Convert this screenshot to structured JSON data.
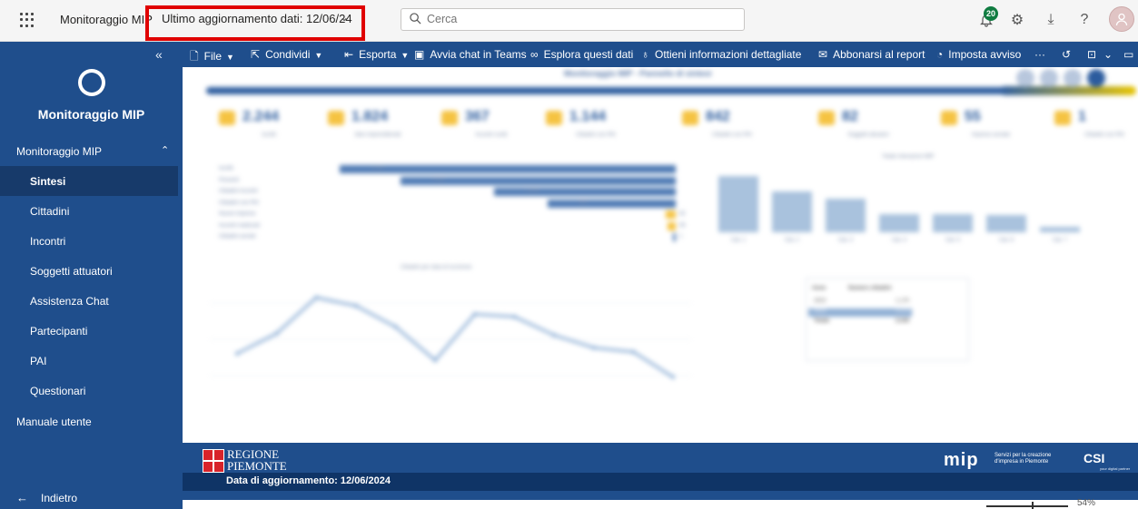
{
  "topbar": {
    "app_title": "Monitoraggio MIP",
    "update_label": "Ultimo aggiornamento dati: 12/06/24",
    "search_placeholder": "Cerca",
    "notification_count": "20",
    "highlight_color": "#e00000"
  },
  "sidebar": {
    "title": "Monitoraggio MIP",
    "section_label": "Monitoraggio MIP",
    "items": [
      {
        "label": "Sintesi",
        "active": true
      },
      {
        "label": "Cittadini",
        "active": false
      },
      {
        "label": "Incontri",
        "active": false
      },
      {
        "label": "Soggetti attuatori",
        "active": false
      },
      {
        "label": "Assistenza Chat",
        "active": false
      },
      {
        "label": "Partecipanti",
        "active": false
      },
      {
        "label": "PAI",
        "active": false
      },
      {
        "label": "Questionari",
        "active": false
      }
    ],
    "manual_label": "Manuale utente",
    "back_label": "Indietro",
    "color": "#1f4e8c"
  },
  "toolbar": {
    "file": "File",
    "share": "Condividi",
    "export": "Esporta",
    "teams": "Avvia chat in Teams",
    "explore": "Esplora questi dati",
    "insights": "Ottieni informazioni dettagliate",
    "subscribe": "Abbonarsi al report",
    "alert": "Imposta avviso",
    "more": "···"
  },
  "report": {
    "title": "Monitoraggio MIP - Pannello di sintesi",
    "kpis": [
      {
        "value": "2.244",
        "label": "Iscritti"
      },
      {
        "value": "1.824",
        "label": "Idee imprenditoriali"
      },
      {
        "value": "367",
        "label": "Incontri svolti"
      },
      {
        "value": "1.144",
        "label": "Cittadini con PAI"
      },
      {
        "value": "842",
        "label": "Cittadini con PAI"
      },
      {
        "value": "82",
        "label": "Soggetti attuatori"
      },
      {
        "value": "55",
        "label": "Imprese avviate"
      },
      {
        "value": "1",
        "label": "Cittadini con PAI"
      }
    ],
    "hbars": [
      {
        "label": "Iscritti",
        "value": "2.244",
        "frac": 1.0
      },
      {
        "label": "Presenti",
        "value": "1.824",
        "frac": 0.82
      },
      {
        "label": "Cittadini incontri",
        "value": "1.144",
        "frac": 0.54
      },
      {
        "label": "Cittadini con PAI",
        "value": "842",
        "frac": 0.38
      },
      {
        "label": "Nuove imprese",
        "value": "82",
        "frac": 0.03
      },
      {
        "label": "Incontri realizzati",
        "value": "55",
        "frac": 0.025
      },
      {
        "label": "Cittadini avviati",
        "value": "1",
        "frac": 0.005
      }
    ],
    "vbar_title": "Totale interazioni MIP",
    "vbars": [
      {
        "cat": "Cat. 1",
        "frac": 1.0
      },
      {
        "cat": "Cat. 2",
        "frac": 0.72
      },
      {
        "cat": "Cat. 3",
        "frac": 0.6
      },
      {
        "cat": "Cat. 4",
        "frac": 0.33
      },
      {
        "cat": "Cat. 5",
        "frac": 0.33
      },
      {
        "cat": "Cat. 6",
        "frac": 0.3
      },
      {
        "cat": "Cat. 7",
        "frac": 0.1
      }
    ],
    "line_title": "Cittadini per data di iscrizione",
    "line_values": [
      48,
      72,
      115,
      105,
      80,
      40,
      95,
      92,
      70,
      55,
      50,
      20
    ],
    "table": {
      "col1": "Anno",
      "col2": "Numero cittadini",
      "rows": [
        [
          "2023",
          "1.170"
        ],
        [
          "2024",
          "1.074"
        ],
        [
          "Totale",
          "2.244"
        ]
      ]
    }
  },
  "footer": {
    "region_line1": "REGIONE",
    "region_line2": "PIEMONTE",
    "date_label": "Data di aggiornamento: 12/06/2024",
    "mip_logo": "mip",
    "mip_subtitle": "Servizi per la creazione d'impresa in Piemonte",
    "csi_logo": "CSI",
    "csi_subtitle": "your digital partner",
    "zoom": "54%"
  }
}
